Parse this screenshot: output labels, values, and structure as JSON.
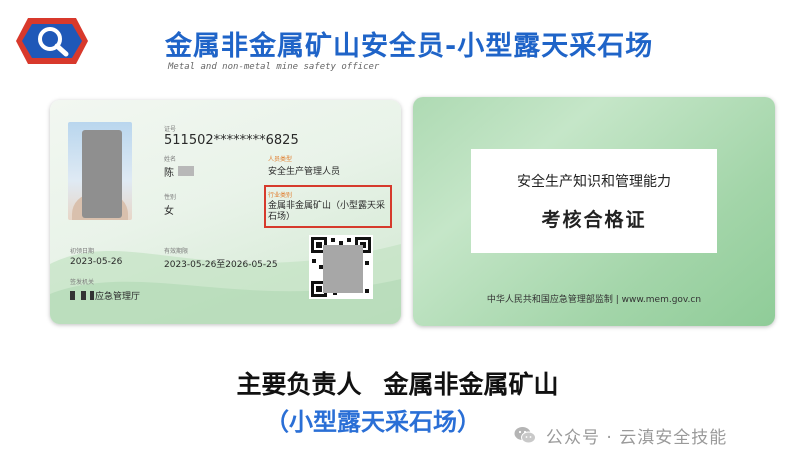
{
  "header": {
    "title": "金属非金属矿山安全员-小型露天采石场",
    "subtitle": "Metal and non-metal mine safety officer"
  },
  "front_card": {
    "cert_no_label": "证号",
    "cert_no": "511502********6825",
    "name_label": "姓名",
    "name": "陈",
    "person_type_label": "人员类型",
    "person_type": "安全生产管理人员",
    "gender_label": "性别",
    "gender": "女",
    "industry_label": "行业类别",
    "industry": "金属非金属矿山（小型露天采石场）",
    "first_issue_label": "初领日期",
    "first_issue": "2023-05-26",
    "validity_label": "有效期限",
    "validity": "2023-05-26至2026-05-25",
    "issuer_label": "签发机关",
    "issuer": "应急管理厅"
  },
  "back_card": {
    "line1": "安全生产知识和管理能力",
    "line2": "考核合格证",
    "footer": "中华人民共和国应急管理部监制 | www.mem.gov.cn"
  },
  "caption": {
    "line1_a": "主要负责人",
    "line1_b": "金属非金属矿山",
    "line2": "（小型露天采石场）"
  },
  "watermark": {
    "text": "公众号 · 云滇安全技能",
    "icon": "wechat-icon"
  },
  "colors": {
    "title_blue": "#1f64c8",
    "logo_red": "#d8392c",
    "highlight_red": "#d63a2c",
    "caption_blue": "#2a6fd6"
  }
}
